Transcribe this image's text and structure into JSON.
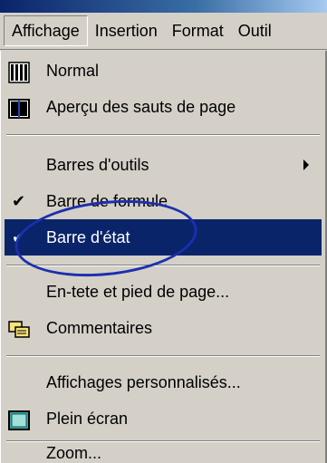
{
  "menubar": {
    "items": [
      {
        "label": "Affichage",
        "active": true
      },
      {
        "label": "Insertion"
      },
      {
        "label": "Format"
      },
      {
        "label": "Outil"
      }
    ]
  },
  "menu": {
    "items": [
      {
        "label": "Normal",
        "icon": "normal-view-icon"
      },
      {
        "label": "Aperçu des sauts de page",
        "icon": "page-break-preview-icon"
      },
      {
        "label": "Barres d'outils",
        "submenu": true
      },
      {
        "label": "Barre de formule",
        "checked": true
      },
      {
        "label": "Barre d'état",
        "checked": true,
        "selected": true
      },
      {
        "label": "En-tete et pied de page..."
      },
      {
        "label": "Commentaires",
        "icon": "comments-icon"
      },
      {
        "label": "Affichages personnalisés..."
      },
      {
        "label": "Plein écran",
        "icon": "full-screen-icon"
      },
      {
        "label": "Zoom..."
      }
    ]
  },
  "colors": {
    "menu_bg": "#d4d0c8",
    "highlight": "#0a246a",
    "annotation": "#1c2fae"
  }
}
